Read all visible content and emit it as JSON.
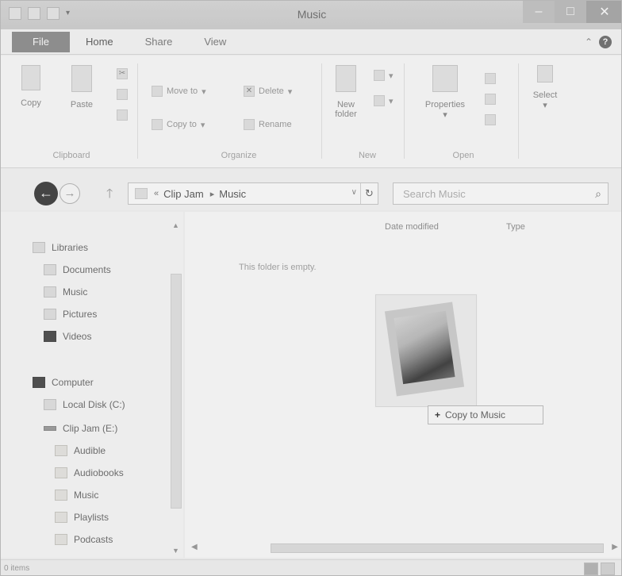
{
  "window": {
    "title": "Music"
  },
  "tabs": [
    "File",
    "Home",
    "Share",
    "View"
  ],
  "ribbon": {
    "clipboard": {
      "copy": "Copy",
      "paste": "Paste",
      "label": "Clipboard"
    },
    "organize": {
      "move_to": "Move to",
      "copy_to": "Copy to",
      "delete": "Delete",
      "rename": "Rename",
      "label": "Organize"
    },
    "new": {
      "new_folder_line1": "New",
      "new_folder_line2": "folder",
      "label": "New"
    },
    "open": {
      "properties": "Properties",
      "label": "Open"
    },
    "select": {
      "select": "Select"
    }
  },
  "address": {
    "crumb1": "Clip Jam",
    "crumb2": "Music",
    "refresh_glyph": "↻",
    "dropdown_glyph": "∨"
  },
  "search": {
    "placeholder": "Search Music",
    "icon_glyph": "⌕"
  },
  "sidebar": {
    "libraries": "Libraries",
    "documents": "Documents",
    "music": "Music",
    "pictures": "Pictures",
    "videos": "Videos",
    "computer": "Computer",
    "local_disk": "Local Disk (C:)",
    "clip_jam": "Clip Jam (E:)",
    "folders": [
      "Audible",
      "Audiobooks",
      "Music",
      "Playlists",
      "Podcasts"
    ]
  },
  "content": {
    "col_date": "Date modified",
    "col_type": "Type",
    "empty_message": "This folder is empty.",
    "drop_tip": "Copy to Music",
    "drop_tip_glyph": "+"
  },
  "status": {
    "items": "0 items"
  }
}
